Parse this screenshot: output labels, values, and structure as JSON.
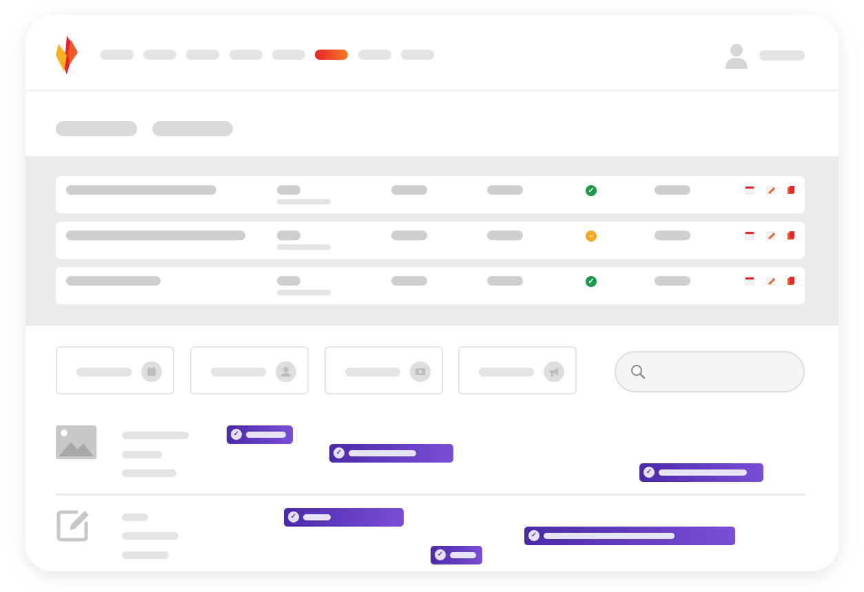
{
  "app": {
    "logo_icon": "flame-logo-icon",
    "brand_colors": {
      "accent": "#f05a28",
      "accent_red": "#e8242a",
      "accent_yellow": "#f7b020",
      "purple": "#5b35c0"
    }
  },
  "nav": {
    "items": [
      {
        "id": "nav-1",
        "active": false
      },
      {
        "id": "nav-2",
        "active": false
      },
      {
        "id": "nav-3",
        "active": false
      },
      {
        "id": "nav-4",
        "active": false
      },
      {
        "id": "nav-5",
        "active": false
      },
      {
        "id": "nav-6",
        "active": true
      },
      {
        "id": "nav-7",
        "active": false
      },
      {
        "id": "nav-8",
        "active": false
      }
    ],
    "user_icon": "user-avatar-icon"
  },
  "table": {
    "rows": [
      {
        "status": "success",
        "status_icon": "check-circle-icon",
        "status_color": "#1a9a4b"
      },
      {
        "status": "pending",
        "status_icon": "minus-circle-icon",
        "status_color": "#f5a623"
      },
      {
        "status": "success",
        "status_icon": "check-circle-icon",
        "status_color": "#1a9a4b"
      }
    ],
    "row_actions": [
      "calendar-icon",
      "edit-icon",
      "document-icon"
    ]
  },
  "filters": [
    {
      "icon": "calendar-icon"
    },
    {
      "icon": "user-icon"
    },
    {
      "icon": "money-icon"
    },
    {
      "icon": "megaphone-icon"
    }
  ],
  "search": {
    "icon": "search-icon",
    "placeholder": ""
  },
  "timeline": {
    "rows": [
      {
        "icon": "image-icon",
        "tags": 3
      },
      {
        "icon": "edit-square-icon",
        "tags": 3
      }
    ],
    "tag_icon": "check-icon"
  }
}
